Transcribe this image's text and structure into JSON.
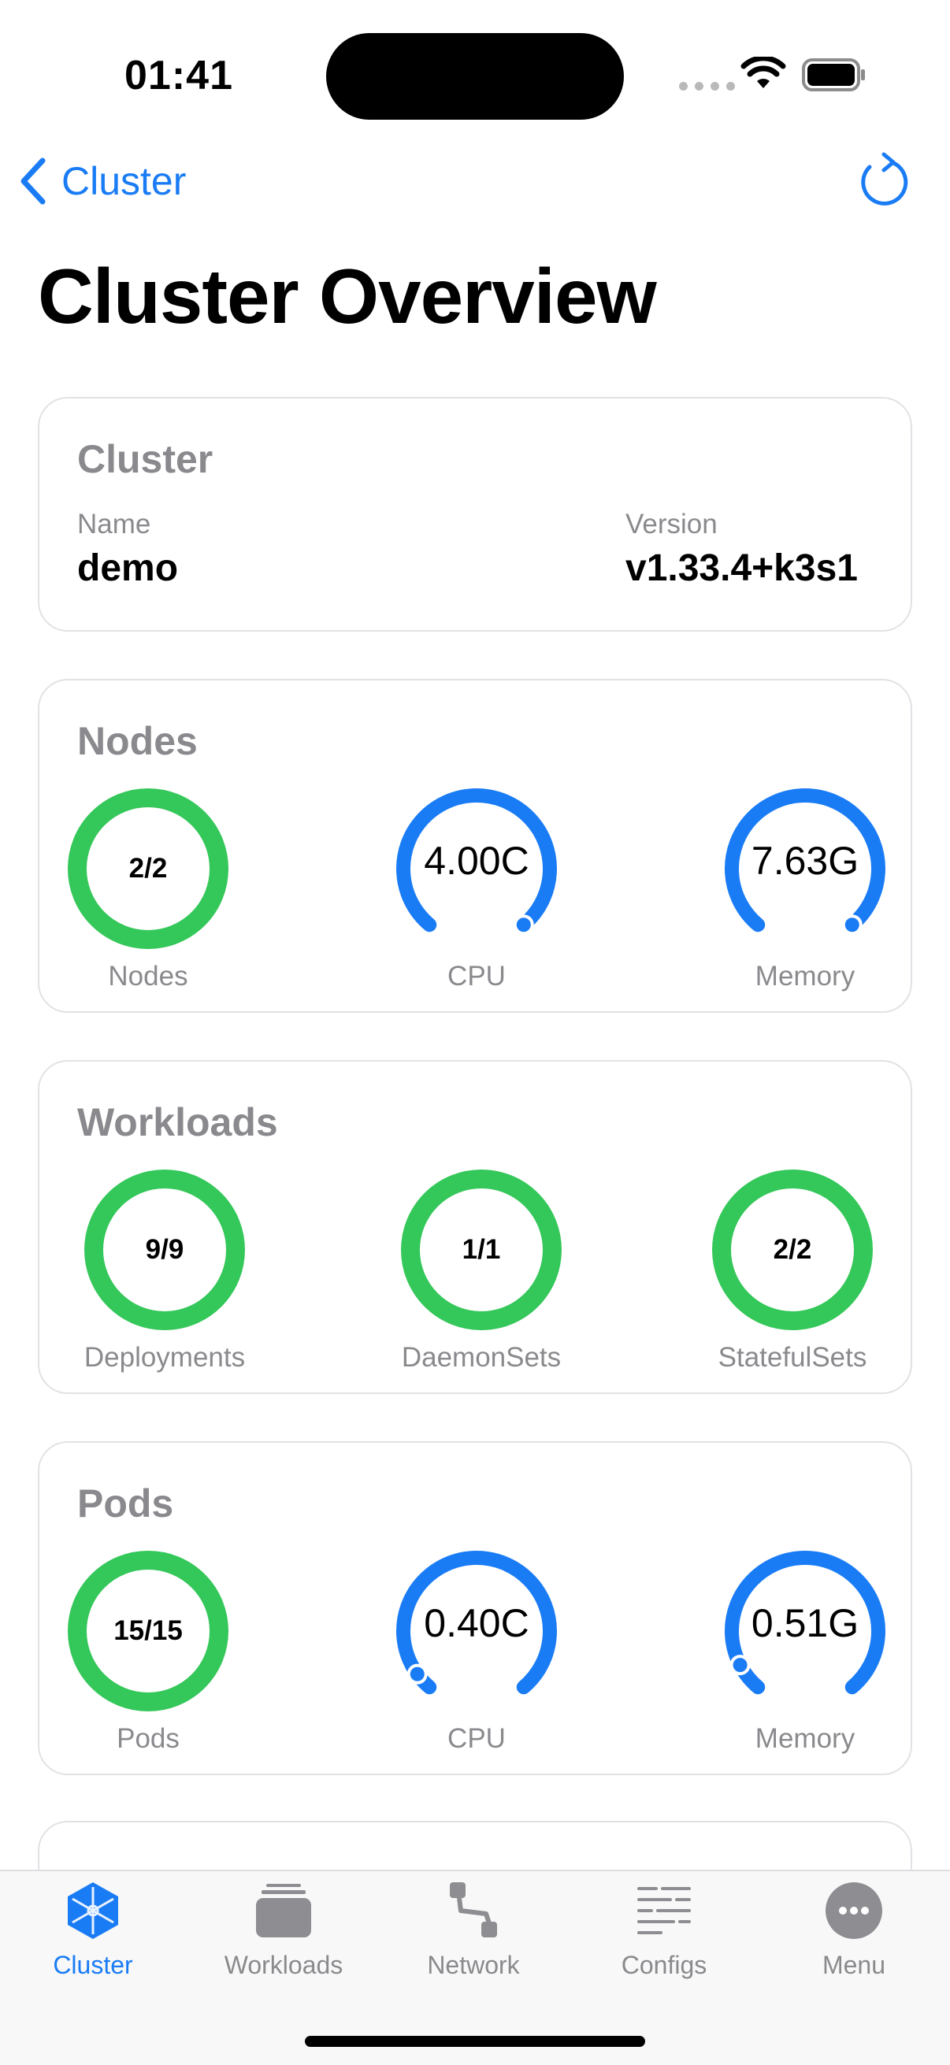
{
  "status_bar": {
    "time": "01:41"
  },
  "nav": {
    "back_label": "Cluster",
    "page_title": "Cluster Overview"
  },
  "colors": {
    "accent": "#1a7cf5",
    "success": "#34c759",
    "track": "#e6e6ea"
  },
  "cluster_card": {
    "title": "Cluster",
    "name_label": "Name",
    "name_value": "demo",
    "version_label": "Version",
    "version_value": "v1.33.4+k3s1"
  },
  "nodes_card": {
    "title": "Nodes",
    "gauges": [
      {
        "value": "2/2",
        "label": "Nodes",
        "kind": "ring",
        "fraction": 1.0
      },
      {
        "value": "4.00C",
        "label": "CPU",
        "kind": "arc",
        "fraction": 1.0
      },
      {
        "value": "7.63G",
        "label": "Memory",
        "kind": "arc",
        "fraction": 1.0
      }
    ]
  },
  "workloads_card": {
    "title": "Workloads",
    "gauges": [
      {
        "value": "9/9",
        "label": "Deployments",
        "kind": "ring",
        "fraction": 1.0
      },
      {
        "value": "1/1",
        "label": "DaemonSets",
        "kind": "ring",
        "fraction": 1.0
      },
      {
        "value": "2/2",
        "label": "StatefulSets",
        "kind": "ring",
        "fraction": 1.0
      }
    ]
  },
  "pods_card": {
    "title": "Pods",
    "gauges": [
      {
        "value": "15/15",
        "label": "Pods",
        "kind": "ring",
        "fraction": 1.0
      },
      {
        "value": "0.40C",
        "label": "CPU",
        "kind": "arc",
        "fraction": 0.05
      },
      {
        "value": "0.51G",
        "label": "Memory",
        "kind": "arc",
        "fraction": 0.08
      }
    ]
  },
  "tabbar": {
    "items": [
      {
        "label": "Cluster",
        "icon": "cube-icon",
        "active": true
      },
      {
        "label": "Workloads",
        "icon": "stack-icon",
        "active": false
      },
      {
        "label": "Network",
        "icon": "network-icon",
        "active": false
      },
      {
        "label": "Configs",
        "icon": "configs-icon",
        "active": false
      },
      {
        "label": "Menu",
        "icon": "ellipsis-circle-icon",
        "active": false
      }
    ]
  }
}
